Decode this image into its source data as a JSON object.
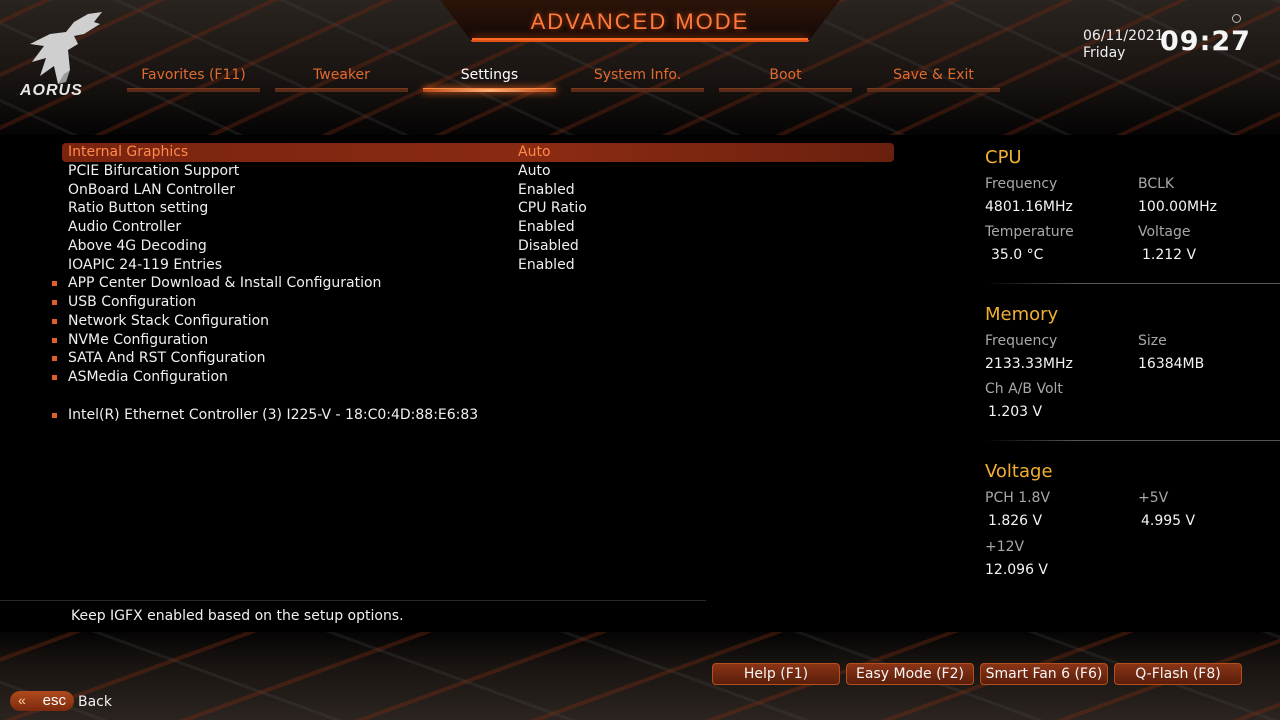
{
  "header": {
    "title": "ADVANCED MODE",
    "brand": "AORUS",
    "date": "06/11/2021",
    "day": "Friday",
    "time": "09:27"
  },
  "tabs": [
    {
      "label": "Favorites (F11)"
    },
    {
      "label": "Tweaker"
    },
    {
      "label": "Settings",
      "active": true
    },
    {
      "label": "System Info."
    },
    {
      "label": "Boot"
    },
    {
      "label": "Save & Exit"
    }
  ],
  "settings": {
    "rows": [
      {
        "label": "Internal Graphics",
        "value": "Auto"
      },
      {
        "label": "PCIE Bifurcation Support",
        "value": "Auto"
      },
      {
        "label": "OnBoard LAN Controller",
        "value": "Enabled"
      },
      {
        "label": "Ratio Button setting",
        "value": "CPU Ratio"
      },
      {
        "label": "Audio Controller",
        "value": "Enabled"
      },
      {
        "label": "Above 4G Decoding",
        "value": "Disabled"
      },
      {
        "label": "IOAPIC 24-119 Entries",
        "value": "Enabled"
      }
    ],
    "submenus": [
      {
        "label": "APP Center Download & Install Configuration"
      },
      {
        "label": "USB Configuration"
      },
      {
        "label": "Network Stack Configuration"
      },
      {
        "label": "NVMe Configuration"
      },
      {
        "label": "SATA And RST Configuration"
      },
      {
        "label": "ASMedia Configuration"
      },
      {
        "label": "Intel(R) Ethernet Controller (3) I225-V - 18:C0:4D:88:E6:83"
      }
    ]
  },
  "help_text": "Keep IGFX enabled based on the setup options.",
  "panel": {
    "cpu": {
      "title": "CPU",
      "frequency_label": "Frequency",
      "frequency": "4801.16MHz",
      "bclk_label": "BCLK",
      "bclk": "100.00MHz",
      "temperature_label": "Temperature",
      "temperature": "35.0 °C",
      "voltage_label": "Voltage",
      "voltage": "1.212 V"
    },
    "memory": {
      "title": "Memory",
      "frequency_label": "Frequency",
      "frequency": "2133.33MHz",
      "size_label": "Size",
      "size": "16384MB",
      "chab_label": "Ch A/B Volt",
      "chab": "1.203 V"
    },
    "voltage": {
      "title": "Voltage",
      "pch_label": "PCH 1.8V",
      "pch": "1.826 V",
      "v5_label": "+5V",
      "v5": "4.995 V",
      "v12_label": "+12V",
      "v12": "12.096 V"
    }
  },
  "footer": {
    "buttons": [
      "Help (F1)",
      "Easy Mode (F2)",
      "Smart Fan 6 (F6)",
      "Q-Flash (F8)"
    ],
    "esc_label": "esc",
    "back_label": "Back"
  },
  "colors": {
    "accent": "#e0602a",
    "panel_title": "#f2b030",
    "selected_row": "#8a2a12"
  }
}
